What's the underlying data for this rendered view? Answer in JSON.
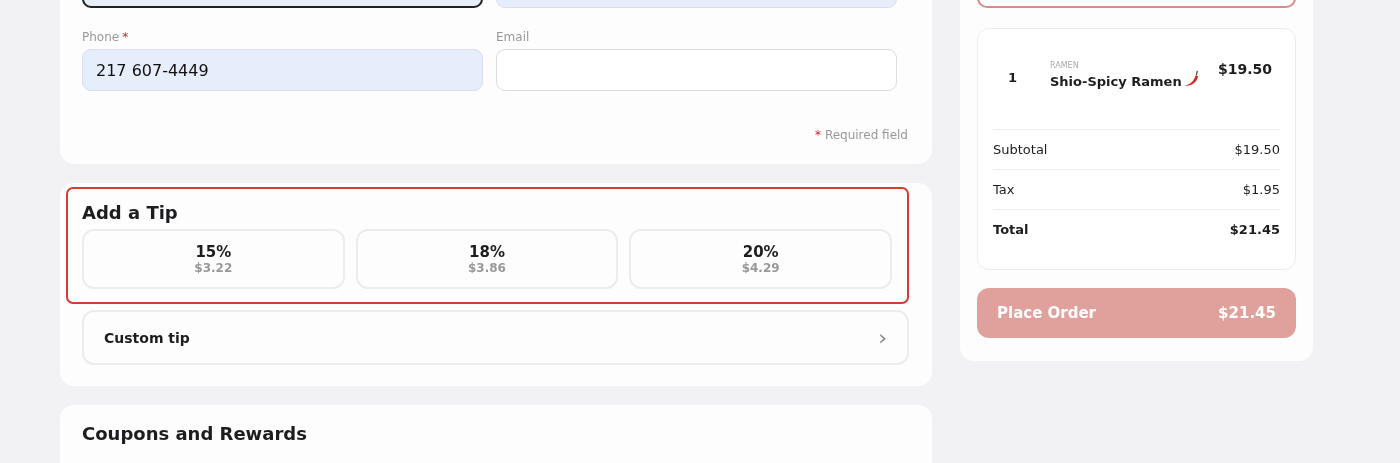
{
  "contact": {
    "top_fields": [
      {
        "focused": true,
        "autofilled": true
      },
      {
        "focused": false,
        "autofilled": true
      }
    ],
    "fields": [
      {
        "label": "Phone",
        "required": true,
        "value": "217 607-4449",
        "autofilled": true
      },
      {
        "label": "Email",
        "required": false,
        "autofilled": false
      }
    ],
    "required_note": {
      "mark": "*",
      "text": "Required field"
    }
  },
  "tip": {
    "title": "Add a Tip",
    "error": true,
    "options": [
      {
        "percent": "15%",
        "amount": "$3.22",
        "selected": false
      },
      {
        "percent": "18%",
        "amount": "$3.86",
        "selected": false
      },
      {
        "percent": "20%",
        "amount": "$4.29",
        "selected": false
      }
    ],
    "custom": {
      "label": "Custom tip",
      "chevron": "›"
    }
  },
  "coupons": {
    "title": "Coupons and Rewards"
  },
  "summary": {
    "top_box": {
      "error": true
    },
    "items": [
      {
        "qty": "1",
        "category": "RAMEN",
        "name": "Shio-Spicy Ramen",
        "spicy": true,
        "price": "$19.50"
      }
    ],
    "lines": [
      {
        "label": "Subtotal",
        "value": "$19.50",
        "bold": false
      },
      {
        "label": "Tax",
        "value": "$1.95",
        "bold": false
      },
      {
        "label": "Total",
        "value": "$21.45",
        "bold": true
      }
    ],
    "place_order": {
      "label": "Place Order",
      "total": "$21.45",
      "disabled": true
    }
  }
}
